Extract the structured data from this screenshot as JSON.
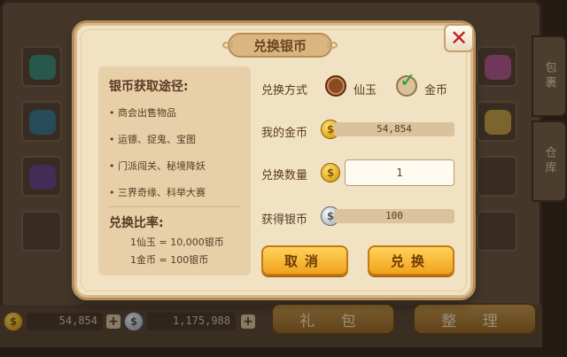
{
  "background": {
    "side_tabs": [
      "包裹",
      "仓库"
    ],
    "bottom": {
      "gold_amount": "54,854",
      "silver_amount": "1,175,988",
      "plus_label": "+",
      "gift_button": "礼 包",
      "sort_button": "整 理"
    }
  },
  "dialog": {
    "title": "兑换银币",
    "close_glyph": "✕",
    "info": {
      "heading": "银币获取途径:",
      "sources": [
        "• 商会出售物品",
        "• 运镖、捉鬼、宝图",
        "• 门派闯关、秘境降妖",
        "• 三界奇缘、科举大赛"
      ],
      "rate_heading": "兑换比率:",
      "rates": [
        "1仙玉 = 10,000银币",
        "1金币 = 100银币"
      ]
    },
    "form": {
      "method_label": "兑换方式",
      "option_jade": "仙玉",
      "option_gold": "金币",
      "selected_option": "金币",
      "my_gold_label": "我的金币",
      "my_gold_value": "54,854",
      "quantity_label": "兑换数量",
      "quantity_value": "1",
      "result_label": "获得银币",
      "result_value": "100"
    },
    "buttons": {
      "cancel": "取消",
      "confirm": "兑换"
    }
  },
  "colors": {
    "dialog_bg": "#f2e2c4",
    "button_yellow": "#f0a21c",
    "close_red": "#c21d1d",
    "check_green": "#22a02a"
  }
}
